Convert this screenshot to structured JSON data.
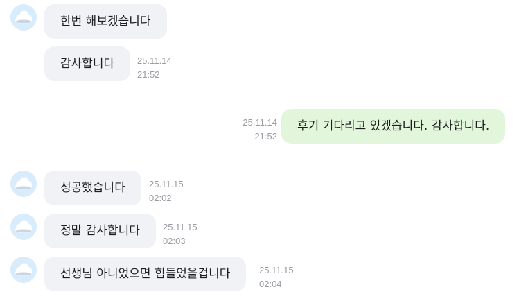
{
  "colors": {
    "incoming_bubble": "#f1f2f6",
    "outgoing_bubble": "#e2f6dc",
    "timestamp": "#9a9ca3",
    "avatar_bg": "#d9ecfb"
  },
  "avatar_icon": "cloud-icon",
  "messages": [
    {
      "direction": "incoming",
      "text": "한번 해보겠습니다",
      "date": "",
      "time": ""
    },
    {
      "direction": "incoming",
      "text": "감사합니다",
      "date": "25.11.14",
      "time": "21:52"
    },
    {
      "direction": "outgoing",
      "text": "후기 기다리고 있겠습니다. 감사합니다.",
      "date": "25.11.14",
      "time": "21:52"
    },
    {
      "direction": "incoming",
      "text": "성공했습니다",
      "date": "25.11.15",
      "time": "02:02"
    },
    {
      "direction": "incoming",
      "text": "정말 감사합니다",
      "date": "25.11.15",
      "time": "02:03"
    },
    {
      "direction": "incoming",
      "text": "선생님 아니었으면 힘들었을겁니다",
      "date": "25.11.15",
      "time": "02:04"
    }
  ]
}
